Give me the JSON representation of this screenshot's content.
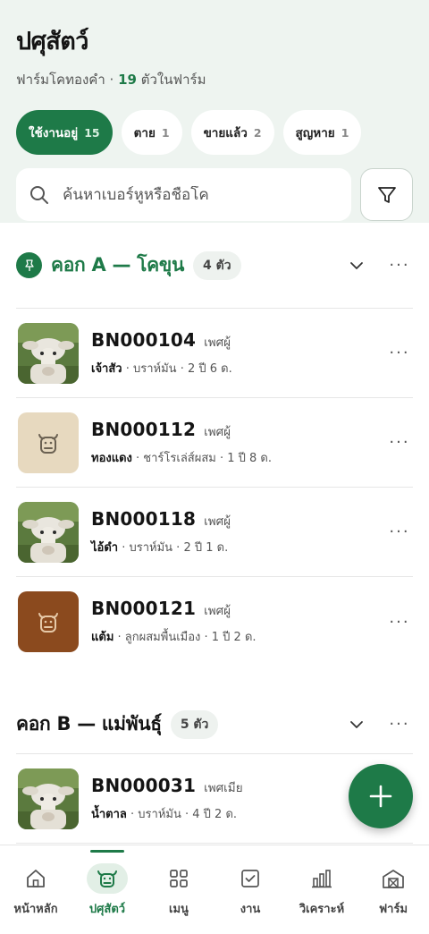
{
  "header": {
    "title": "ปศุสัตว์",
    "farm": "ฟาร์มโคทองคำ ·",
    "count": "19",
    "count_suffix": "ตัวในฟาร์ม"
  },
  "filters": [
    {
      "label": "ใช้งานอยู่",
      "count": "15",
      "active": true
    },
    {
      "label": "ตาย",
      "count": "1"
    },
    {
      "label": "ขายแล้ว",
      "count": "2"
    },
    {
      "label": "สูญหาย",
      "count": "1"
    }
  ],
  "search": {
    "placeholder": "ค้นหาเบอร์หูหรือชื่อโค"
  },
  "groups": [
    {
      "name": "คอก A — โคขุน",
      "count": "4 ตัว",
      "animals": [
        {
          "tag": "BN000104",
          "sex": "เพศผู้",
          "nick": "เจ้าสัว",
          "detail": " · บราห์มัน · 2 ปี 6 ด."
        },
        {
          "tag": "BN000112",
          "sex": "เพศผู้",
          "nick": "ทองแดง",
          "detail": " · ชาร์โรเล่ส์ผสม · 1 ปี 8 ด."
        },
        {
          "tag": "BN000118",
          "sex": "เพศผู้",
          "nick": "ไอ้ดำ",
          "detail": " · บราห์มัน · 2 ปี 1 ด."
        },
        {
          "tag": "BN000121",
          "sex": "เพศผู้",
          "nick": "แต้ม",
          "detail": " · ลูกผสมพื้นเมือง · 1 ปี 2 ด."
        }
      ]
    },
    {
      "name": "คอก B — แม่พันธุ์",
      "count": "5 ตัว",
      "animals": [
        {
          "tag": "BN000031",
          "sex": "เพศเมีย",
          "nick": "น้ำตาล",
          "detail": " · บราห์มัน · 4 ปี 2 ด."
        }
      ]
    }
  ],
  "nav": [
    {
      "label": "หน้าหลัก",
      "icon": "home-icon"
    },
    {
      "label": "ปศุสัตว์",
      "icon": "cow-icon",
      "active": true
    },
    {
      "label": "เมนู",
      "icon": "grid-icon"
    },
    {
      "label": "งาน",
      "icon": "task-check-icon"
    },
    {
      "label": "วิเคราะห์",
      "icon": "bar-chart-icon"
    },
    {
      "label": "ฟาร์ม",
      "icon": "barn-icon"
    }
  ],
  "colors": {
    "accent": "#1e7a48",
    "background_top": "#eef4f0"
  }
}
